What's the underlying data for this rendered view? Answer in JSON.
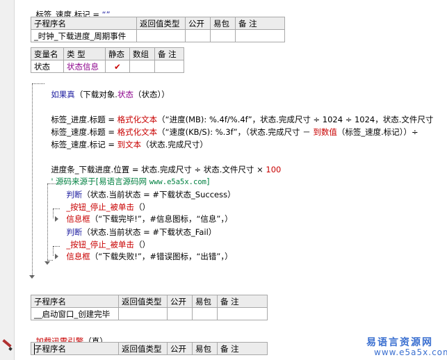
{
  "code": {
    "line0": {
      "target": "标签_速度.标记",
      "op": " = ",
      "value": "“”"
    },
    "sub1": {
      "header": [
        "子程序名",
        "返回值类型",
        "公开",
        "易包",
        "备 注"
      ],
      "name": "_时钟_下载进度_周期事件"
    },
    "var1": {
      "header": [
        "变量名",
        "类 型",
        "静态",
        "数组",
        "备 注"
      ],
      "name": "状态",
      "type": "状态信息",
      "static_mark": "✔"
    },
    "if1": {
      "kw": "如果真",
      "open": "（下载对象.",
      "mid": "状态",
      "close": "（状态））"
    },
    "l_title1": {
      "lhs": "标签_进度.标题",
      "eq": " = ",
      "fn": "格式化文本",
      "args": "（“进度(MB): %.4f/%.4f”，状态.完成尺寸 ÷ 1024 ÷ 1024，状态.文件尺寸"
    },
    "l_title2": {
      "lhs": "标签_速度.标题",
      "eq": " = ",
      "fn": "格式化文本",
      "args_a": "（“速度(KB/S): %.3f”，（状态.完成尺寸 － ",
      "fn2": "到数值",
      "args_b": "（标签_速度.标记））÷"
    },
    "l_mark": {
      "lhs": "标签_速度.标记",
      "eq": " = ",
      "fn": "到文本",
      "args": "（状态.完成尺寸）"
    },
    "l_pos": {
      "lhs": "进度条_下载进度.位置",
      "rest": " = 状态.完成尺寸 ÷ 状态.文件尺寸 × ",
      "num": "100"
    },
    "l_comment": {
      "text": "' 源码来源于[易语言源码网 ",
      "url": "www.e5a5x.com",
      "close": "]"
    },
    "j1": {
      "kw": "判断",
      "args": "（状态.当前状态 = #下载状态_Success）"
    },
    "j1_call": {
      "fn": "_按钮_停止_被单击",
      "args": "（）"
    },
    "j1_msg": {
      "fn": "信息框",
      "args_a": "（“下载完毕!”，#信息图标，“信息”，）"
    },
    "j2": {
      "kw": "判断",
      "args": "（状态.当前状态 = #下载状态_Fail）"
    },
    "j2_call": {
      "fn": "_按钮_停止_被单击",
      "args": "（）"
    },
    "j2_msg": {
      "fn": "信息框",
      "args_a": "（“下载失败!”，#错误图标，“出错”，）"
    },
    "sub2": {
      "header": [
        "子程序名",
        "返回值类型",
        "公开",
        "易包",
        "备 注"
      ],
      "name": "__启动窗口_创建完毕"
    },
    "load": {
      "fn": "加载迅雷引擎",
      "args": "（真）"
    },
    "sub3": {
      "header": [
        "子程序名",
        "返回值类型",
        "公开",
        "易包",
        "备 注"
      ]
    }
  },
  "watermark": {
    "line1": "易语言资源网",
    "line2": "www.e5a5x.com"
  },
  "colors": {
    "keyword": "#1f1fa0",
    "function": "#c80000",
    "comment": "#008040",
    "member": "#8b008b"
  }
}
